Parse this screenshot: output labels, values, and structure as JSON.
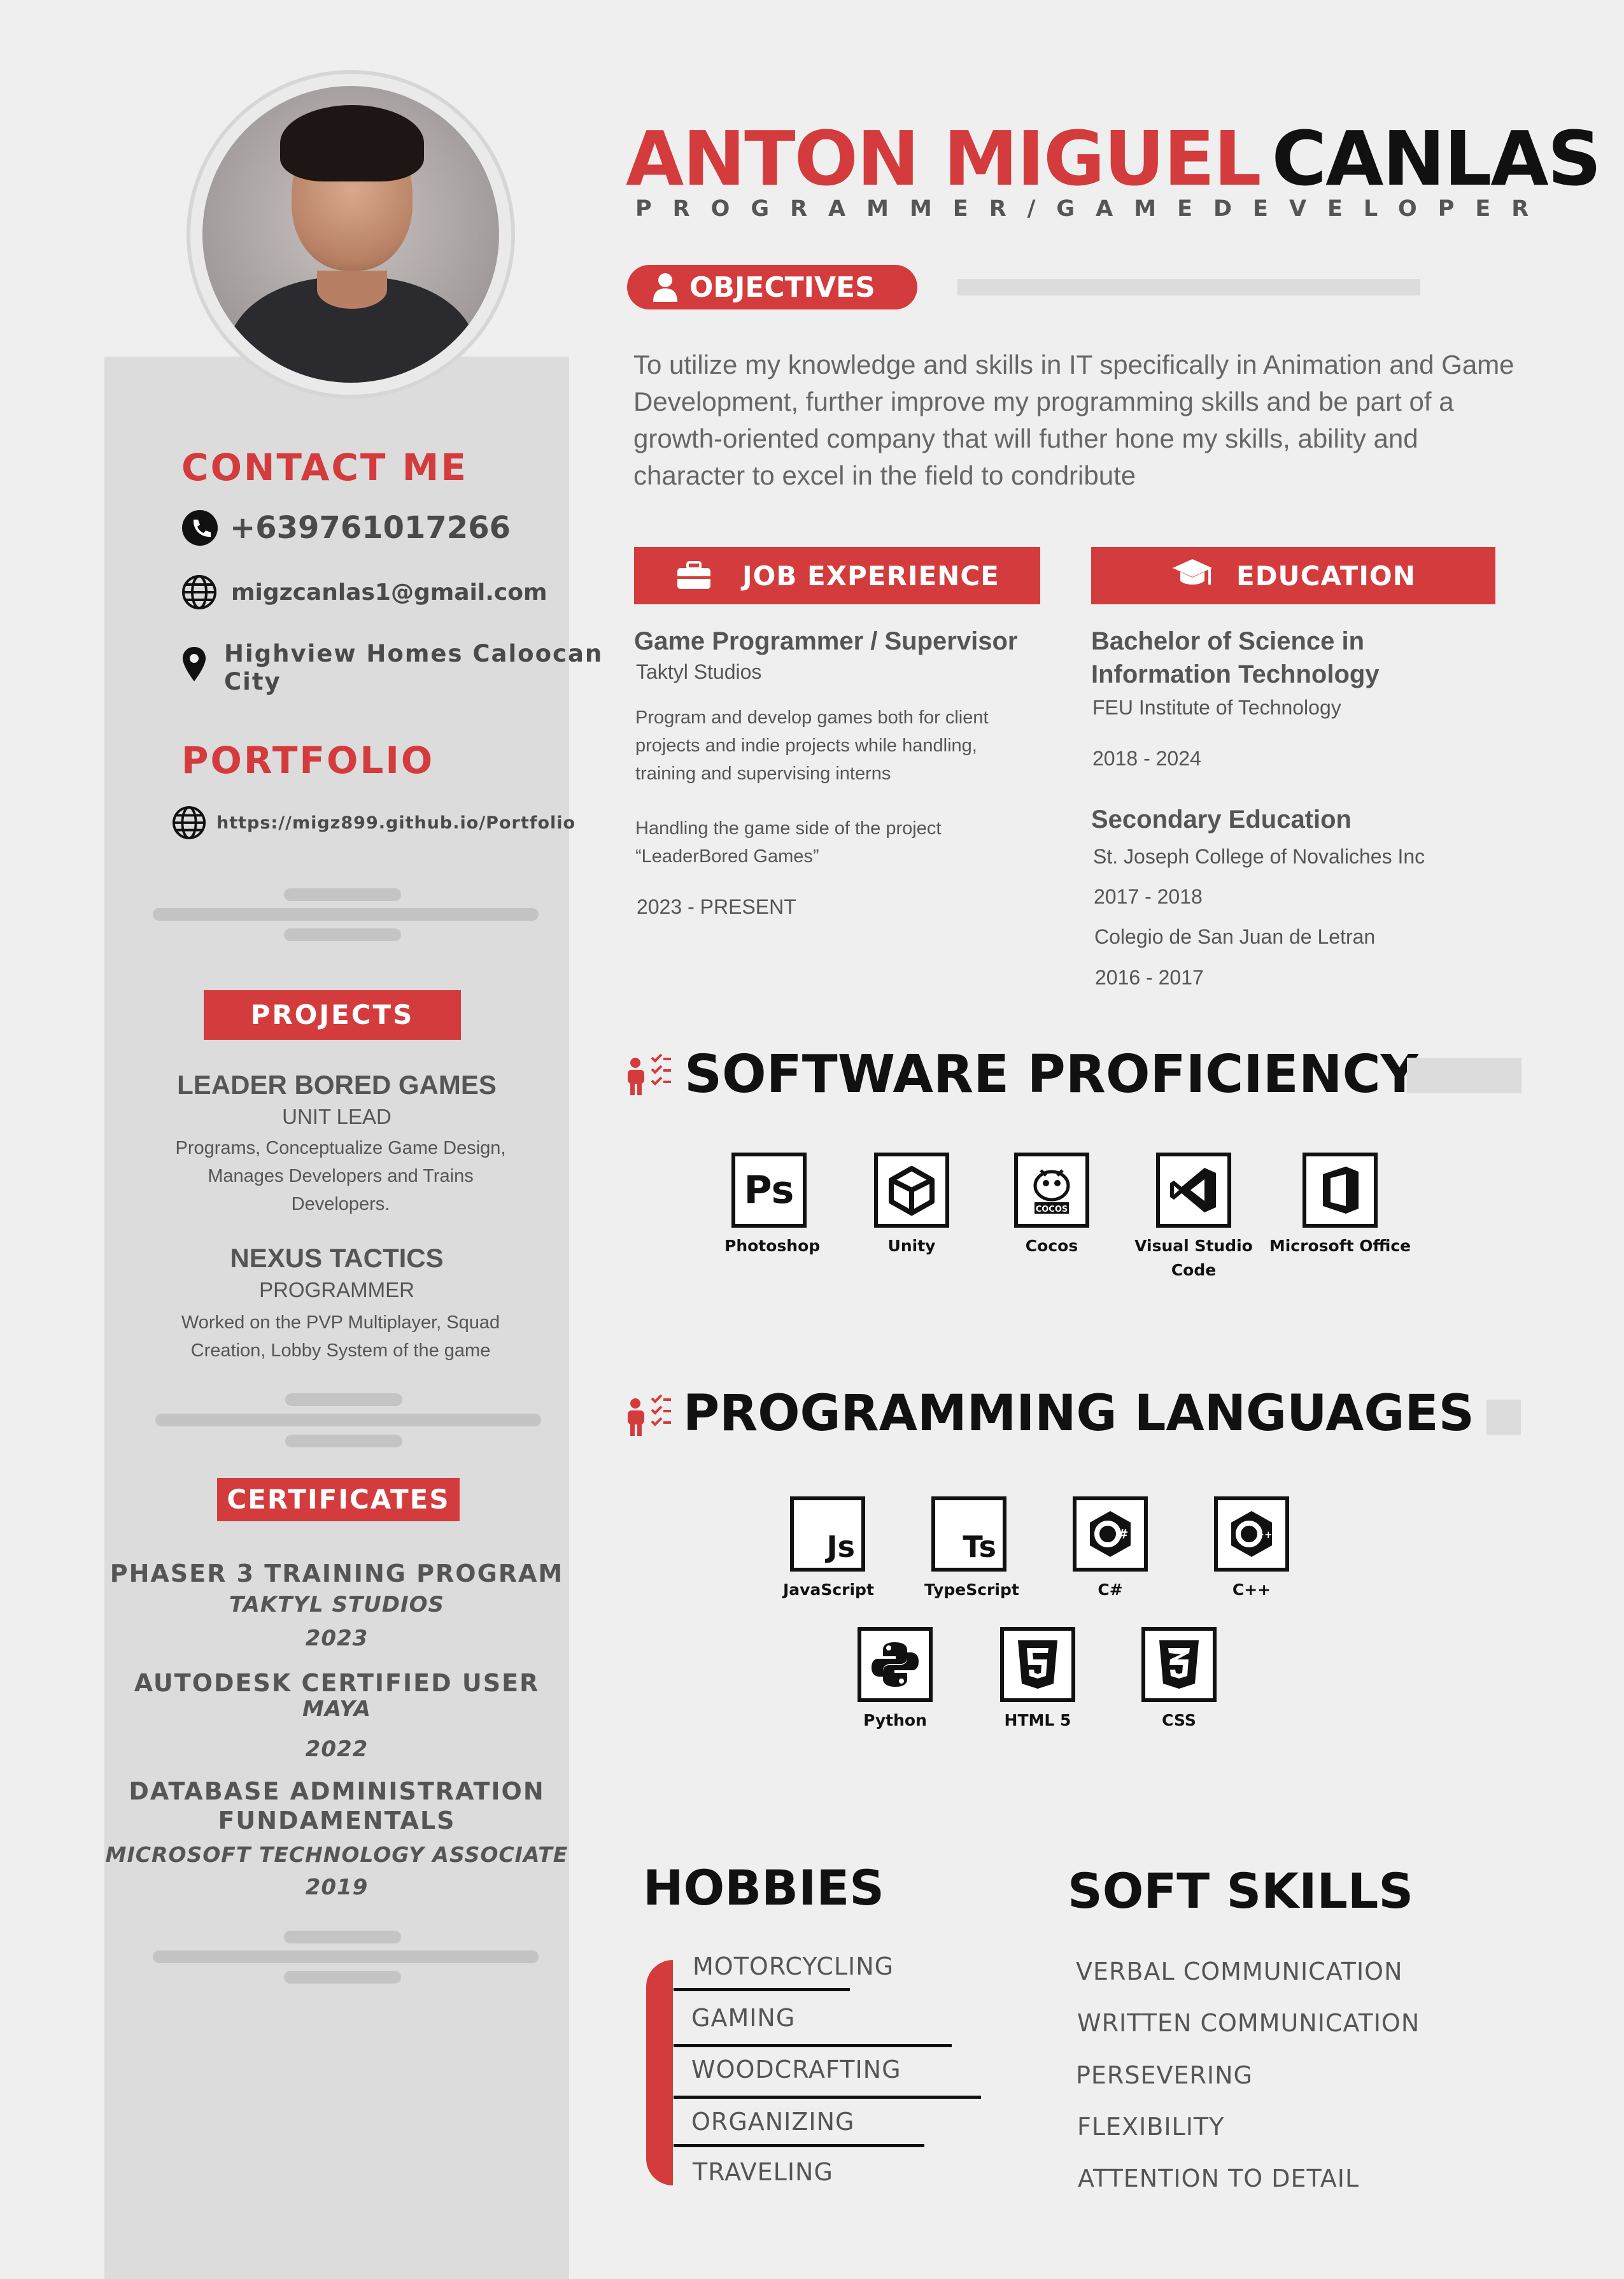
{
  "header": {
    "first_name": "ANTON MIGUEL",
    "last_name": "CANLAS",
    "title": "PROGRAMMER/GAMEDEVELOPER"
  },
  "objectives": {
    "heading": "OBJECTIVES",
    "text": "To utilize my knowledge and skills in IT specifically in Animation and Game Development, further improve my programming skills and be part of a growth-oriented company that will futher hone my skills, ability and character to excel in the field to condribute"
  },
  "contact": {
    "heading": "CONTACT ME",
    "phone": "+639761017266",
    "email": "migzcanlas1@gmail.com",
    "address_line1": "Highview Homes Caloocan",
    "address_line2": "City"
  },
  "portfolio": {
    "heading": "PORTFOLIO",
    "url": "https://migz899.github.io/Portfolio"
  },
  "projects": {
    "heading": "PROJECTS",
    "items": [
      {
        "title": "LEADER BORED GAMES",
        "role": "UNIT LEAD",
        "desc": "Programs, Conceptualize Game Design, Manages Developers and Trains Developers."
      },
      {
        "title": "NEXUS TACTICS",
        "role": "PROGRAMMER",
        "desc": "Worked on the PVP Multiplayer, Squad Creation, Lobby System of the game"
      }
    ]
  },
  "certificates": {
    "heading": "CERTIFICATES",
    "items": [
      {
        "title": "PHASER 3 TRAINING PROGRAM",
        "issuer": "TAKTYL STUDIOS",
        "year": "2023"
      },
      {
        "title": "AUTODESK CERTIFIED USER",
        "issuer": "MAYA",
        "year": "2022"
      },
      {
        "title_line1": "DATABASE ADMINISTRATION",
        "title_line2": "FUNDAMENTALS",
        "issuer": "MICROSOFT TECHNOLOGY ASSOCIATE",
        "year": "2019"
      }
    ]
  },
  "experience": {
    "heading": "JOB EXPERIENCE",
    "title": "Game Programmer / Supervisor",
    "company": "Taktyl Studios",
    "desc1": "Program and develop games both for client projects and indie projects while handling, training and supervising interns",
    "desc2_line1": "Handling the game side of the project",
    "desc2_line2": "“LeaderBored Games”",
    "period": "2023 - PRESENT"
  },
  "education": {
    "heading": "EDUCATION",
    "degree_line1": "Bachelor of Science in",
    "degree_line2": "Information Technology",
    "school": "FEU Institute of Technology",
    "years": "2018 - 2024",
    "secondary_heading": "Secondary Education",
    "school2": "St. Joseph College of Novaliches Inc",
    "years2": "2017 - 2018",
    "school3": "Colegio de San Juan de Letran",
    "years3": "2016 - 2017"
  },
  "software": {
    "heading": "SOFTWARE PROFICIENCY",
    "items": [
      {
        "label": "Photoshop",
        "glyph": "Ps",
        "icon": "photoshop-icon"
      },
      {
        "label": "Unity",
        "glyph": "",
        "icon": "unity-icon"
      },
      {
        "label": "Cocos",
        "glyph": "",
        "icon": "cocos-icon"
      },
      {
        "label_line1": "Visual Studio",
        "label_line2": "Code",
        "icon": "vscode-icon"
      },
      {
        "label": "Microsoft Office",
        "icon": "office-icon"
      }
    ]
  },
  "languages": {
    "heading": "PROGRAMMING LANGUAGES",
    "items": [
      {
        "label": "JavaScript",
        "glyph": "Js",
        "icon": "javascript-icon"
      },
      {
        "label": "TypeScript",
        "glyph": "Ts",
        "icon": "typescript-icon"
      },
      {
        "label": "C#",
        "glyph": "C#",
        "icon": "csharp-icon"
      },
      {
        "label": "C++",
        "glyph": "C++",
        "icon": "cpp-icon"
      },
      {
        "label": "Python",
        "icon": "python-icon"
      },
      {
        "label": "HTML 5",
        "glyph": "5",
        "icon": "html5-icon"
      },
      {
        "label": "CSS",
        "glyph": "3",
        "icon": "css-icon"
      }
    ]
  },
  "hobbies": {
    "heading": "HOBBIES",
    "items": [
      "MOTORCYCLING",
      "GAMING",
      "WOODCRAFTING",
      "ORGANIZING",
      "TRAVELING"
    ]
  },
  "soft_skills": {
    "heading": "SOFT SKILLS",
    "items": [
      "VERBAL COMMUNICATION",
      "WRITTEN COMMUNICATION",
      "PERSEVERING",
      "FLEXIBILITY",
      "ATTENTION TO DETAIL"
    ]
  },
  "colors": {
    "accent": "#d43b3c",
    "sidebar": "#dcdcdc",
    "background": "#efefef",
    "dark": "#111111"
  }
}
